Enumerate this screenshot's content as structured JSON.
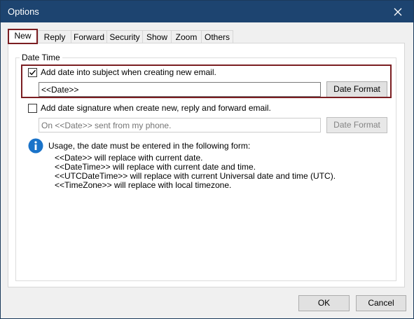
{
  "window": {
    "title": "Options"
  },
  "tabs": [
    {
      "label": "New",
      "active": true
    },
    {
      "label": "Reply"
    },
    {
      "label": "Forward"
    },
    {
      "label": "Security"
    },
    {
      "label": "Show"
    },
    {
      "label": "Zoom"
    },
    {
      "label": "Others"
    }
  ],
  "group": {
    "legend": "Date Time"
  },
  "subject_option": {
    "label": "Add date into subject when creating new email.",
    "checked": true,
    "value": "<<Date>>",
    "button": "Date Format"
  },
  "signature_option": {
    "label": "Add date signature when create new, reply and forward email.",
    "checked": false,
    "placeholder": "On <<Date>> sent from my phone.",
    "button": "Date Format"
  },
  "usage": {
    "intro": "Usage, the date must be entered in the following form:",
    "lines": [
      "<<Date>> will replace with current date.",
      "<<DateTime>> will replace with current date and time.",
      "<<UTCDateTime>> will replace with current Universal date and time (UTC).",
      "<<TimeZone>> will replace with local timezone."
    ]
  },
  "footer": {
    "ok": "OK",
    "cancel": "Cancel"
  },
  "colors": {
    "titlebar": "#1d4470",
    "highlight": "#7b1e22",
    "info": "#1a73c9"
  }
}
